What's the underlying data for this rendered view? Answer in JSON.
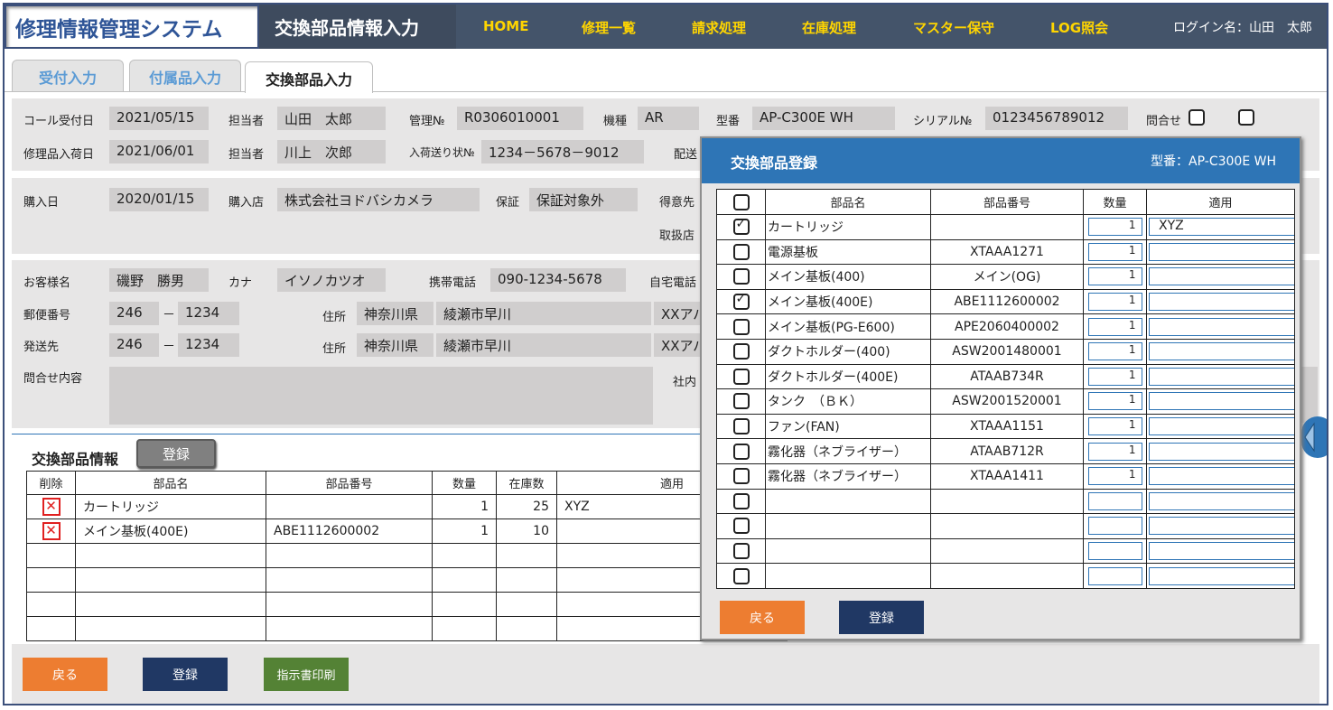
{
  "header": {
    "app_title": "修理情報管理システム",
    "page_title": "交換部品情報入力",
    "nav": [
      "HOME",
      "修理一覧",
      "請求処理",
      "在庫処理",
      "マスター保守",
      "LOG照会"
    ],
    "login": "ログイン名：山田　太郎"
  },
  "tabs": [
    "受付入力",
    "付属品入力",
    "交換部品入力"
  ],
  "reception": {
    "call_date_label": "コール受付日",
    "call_date": "2021/05/15",
    "staff_label": "担当者",
    "staff": "山田　太郎",
    "mgmt_no_label": "管理№",
    "mgmt_no": "R0306010001",
    "model_type_label": "機種",
    "model_type": "AR",
    "model_no_label": "型番",
    "model_no": "AP-C300E WH",
    "serial_label": "シリアル№",
    "serial": "0123456789012",
    "inquiry_label": "問合せ",
    "arrival_label": "修理品入荷日",
    "arrival": "2021/06/01",
    "staff2_label": "担当者",
    "staff2": "川上　次郎",
    "waybill_label": "入荷送り状№",
    "waybill": "1234－5678－9012",
    "delivery_label": "配送"
  },
  "purchase": {
    "date_label": "購入日",
    "date": "2020/01/15",
    "store_label": "購入店",
    "store": "株式会社ヨドバシカメラ",
    "warranty_label": "保証",
    "warranty": "保証対象外",
    "client_label": "得意先",
    "dealer_label": "取扱店"
  },
  "customer": {
    "name_label": "お客様名",
    "name": "磯野　勝男",
    "kana_label": "カナ",
    "kana": "イソノカツオ",
    "mobile_label": "携帯電話",
    "mobile": "090-1234-5678",
    "home_label": "自宅電話",
    "zip_label": "郵便番号",
    "zip1": "246",
    "zip_sep": "－",
    "zip2": "1234",
    "addr_label": "住所",
    "pref": "神奈川県",
    "city": "綾瀬市早川",
    "addr_rest": "XXアパ",
    "ship_label": "発送先",
    "ship_zip1": "246",
    "ship_zip2": "1234",
    "ship_addr_label": "住所",
    "ship_pref": "神奈川県",
    "ship_city": "綾瀬市早川",
    "ship_addr_rest": "XXアパ",
    "inquiry_content_label": "問合せ内容",
    "internal_label": "社内"
  },
  "parts": {
    "title": "交換部品情報",
    "register_label": "登録",
    "columns": [
      "削除",
      "部品名",
      "部品番号",
      "数量",
      "在庫数",
      "適用"
    ],
    "delete_symbol": "✕",
    "rows": [
      {
        "name": "カートリッジ",
        "number": "",
        "qty": "1",
        "stock": "25",
        "apply": "XYZ"
      },
      {
        "name": "メイン基板(400E)",
        "number": "ABE1112600002",
        "qty": "1",
        "stock": "10",
        "apply": ""
      }
    ]
  },
  "footer": {
    "back": "戻る",
    "register": "登録",
    "print": "指示書印刷"
  },
  "modal": {
    "title": "交換部品登録",
    "model": "型番：AP-C300E WH",
    "columns": [
      "部品名",
      "部品番号",
      "数量",
      "適用"
    ],
    "rows": [
      {
        "checked": true,
        "name": "カートリッジ",
        "number": "",
        "qty": "1",
        "apply": "XYZ"
      },
      {
        "checked": false,
        "name": "電源基板",
        "number": "XTAAA1271",
        "qty": "1",
        "apply": ""
      },
      {
        "checked": false,
        "name": "メイン基板(400)",
        "number": "メイン(OG)",
        "qty": "1",
        "apply": ""
      },
      {
        "checked": true,
        "name": "メイン基板(400E)",
        "number": "ABE1112600002",
        "qty": "1",
        "apply": ""
      },
      {
        "checked": false,
        "name": "メイン基板(PG-E600)",
        "number": "APE2060400002",
        "qty": "1",
        "apply": ""
      },
      {
        "checked": false,
        "name": "ダクトホルダー(400)",
        "number": "ASW2001480001",
        "qty": "1",
        "apply": ""
      },
      {
        "checked": false,
        "name": "ダクトホルダー(400E)",
        "number": "ATAAB734R",
        "qty": "1",
        "apply": ""
      },
      {
        "checked": false,
        "name": "タンク　（ＢＫ）",
        "number": "ASW2001520001",
        "qty": "1",
        "apply": ""
      },
      {
        "checked": false,
        "name": "ファン(FAN)",
        "number": "XTAAA1151",
        "qty": "1",
        "apply": ""
      },
      {
        "checked": false,
        "name": "霧化器（ネブライザー）",
        "number": "ATAAB712R",
        "qty": "1",
        "apply": ""
      },
      {
        "checked": false,
        "name": "霧化器（ネブライザー）",
        "number": "XTAAA1411",
        "qty": "1",
        "apply": ""
      },
      {
        "checked": false,
        "name": "",
        "number": "",
        "qty": "",
        "apply": ""
      },
      {
        "checked": false,
        "name": "",
        "number": "",
        "qty": "",
        "apply": ""
      },
      {
        "checked": false,
        "name": "",
        "number": "",
        "qty": "",
        "apply": ""
      },
      {
        "checked": false,
        "name": "",
        "number": "",
        "qty": "",
        "apply": ""
      }
    ],
    "back": "戻る",
    "register": "登録"
  },
  "colors": {
    "header_bg": "#44546a",
    "nav_text": "#ffd500",
    "modal_header": "#2e75b6",
    "orange": "#ed7d31",
    "navy": "#203864",
    "green": "#548235"
  }
}
